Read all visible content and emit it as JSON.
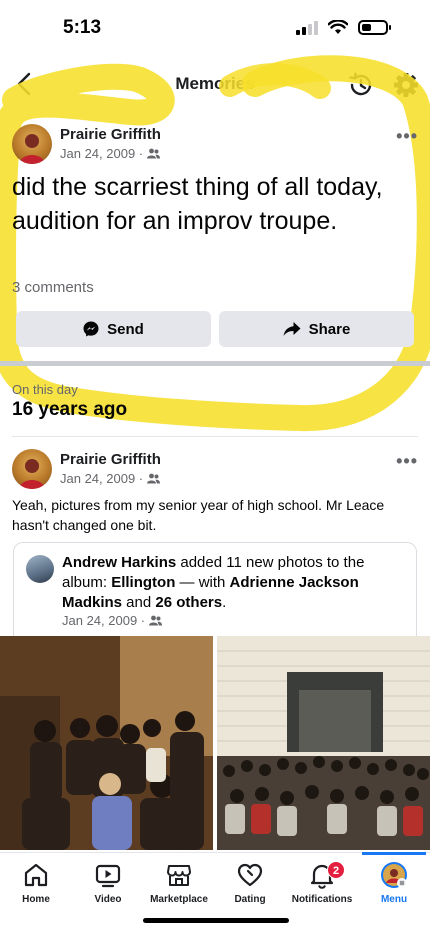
{
  "status_bar": {
    "time": "5:13"
  },
  "header": {
    "title": "Memories"
  },
  "memory_post": {
    "author": "Prairie Griffith",
    "date": "Jan 24, 2009 ·",
    "text": "did the scarriest thing of all today, audition for an improv troupe.",
    "comments": "3 comments",
    "send_label": "Send",
    "share_label": "Share"
  },
  "section": {
    "label": "On this day",
    "years": "16 years ago"
  },
  "photo_post": {
    "author": "Prairie Griffith",
    "date": "Jan 24, 2009 ·",
    "text": "Yeah, pictures from my senior year of high school.  Mr Leace hasn't changed one bit.",
    "shared": {
      "author": "Andrew Harkins",
      "action": " added 11 new photos to the album: ",
      "album": "Ellington",
      "with": " — with ",
      "tagged": "Adrienne Jackson Madkins",
      "and": " and ",
      "others": "26 others",
      "end": ".",
      "date": "Jan 24, 2009 ·"
    }
  },
  "tabs": [
    {
      "label": "Home",
      "icon": "home-icon"
    },
    {
      "label": "Video",
      "icon": "video-icon"
    },
    {
      "label": "Marketplace",
      "icon": "marketplace-icon"
    },
    {
      "label": "Dating",
      "icon": "dating-icon"
    },
    {
      "label": "Notifications",
      "icon": "bell-icon",
      "badge": "2"
    },
    {
      "label": "Menu",
      "icon": "avatar-icon"
    }
  ],
  "colors": {
    "accent": "#1877f2",
    "highlight": "#f7df2a",
    "badge": "#e41e3f"
  }
}
